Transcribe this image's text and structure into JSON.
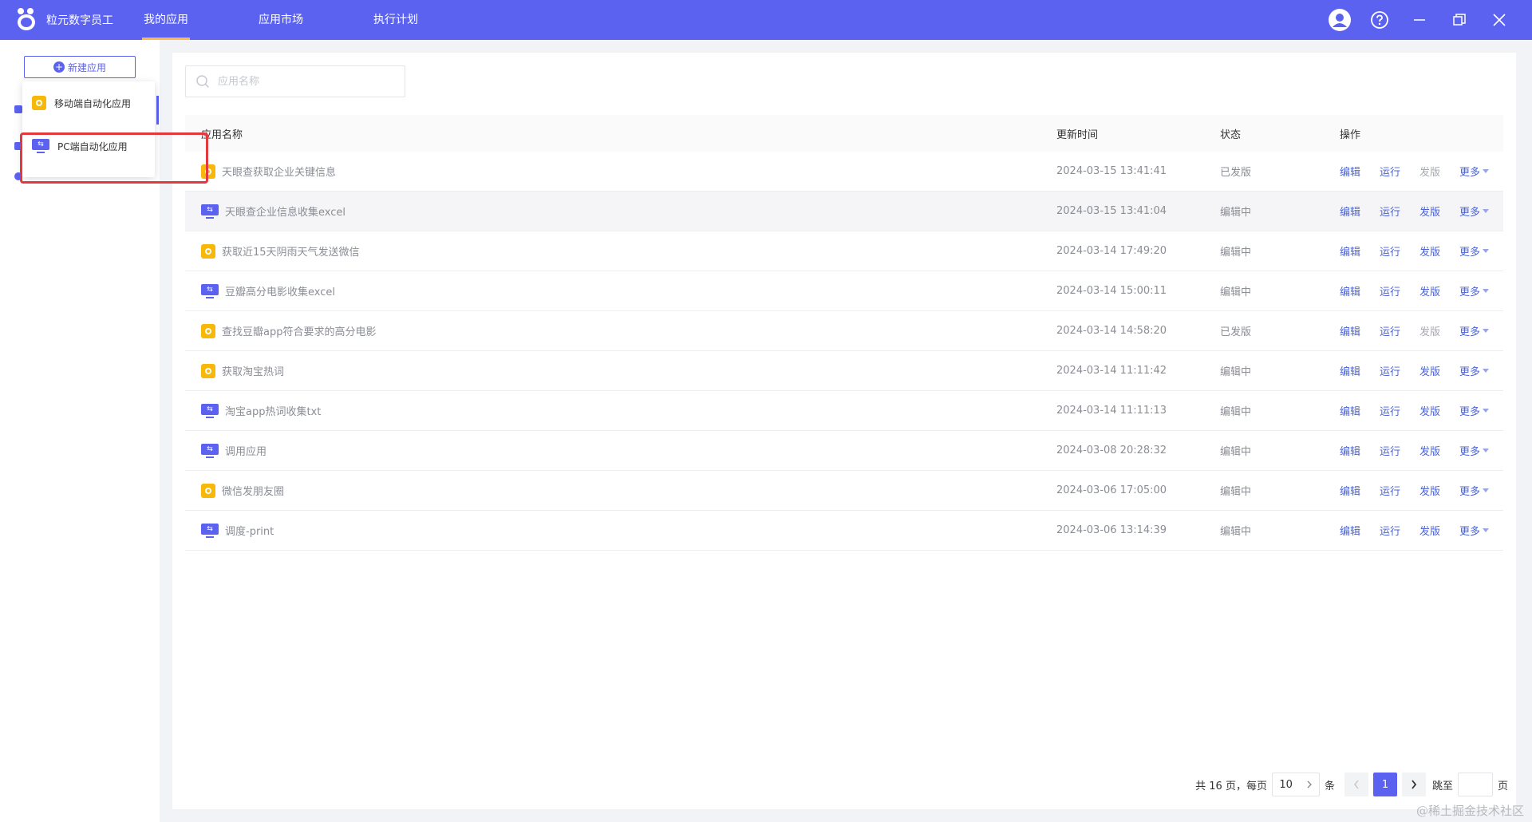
{
  "app": {
    "title": "粒元数字员工"
  },
  "nav": [
    {
      "label": "我的应用",
      "active": true
    },
    {
      "label": "应用市场",
      "active": false
    },
    {
      "label": "执行计划",
      "active": false
    }
  ],
  "window_icons": [
    "user-avatar-icon",
    "help-icon",
    "minimize-icon",
    "restore-icon",
    "close-icon"
  ],
  "sidebar": {
    "new_app_label": "新建应用"
  },
  "dropdown": {
    "items": [
      {
        "label": "移动端自动化应用",
        "icon": "mobile-app-icon"
      },
      {
        "label": "PC端自动化应用",
        "icon": "pc-app-icon"
      }
    ]
  },
  "search": {
    "placeholder": "应用名称"
  },
  "table": {
    "headers": {
      "name": "应用名称",
      "time": "更新时间",
      "status": "状态",
      "ops": "操作"
    },
    "op_labels": {
      "edit": "编辑",
      "run": "运行",
      "publish": "发版",
      "more": "更多"
    },
    "rows": [
      {
        "type": "mobile",
        "name": "天眼查获取企业关键信息",
        "time": "2024-03-15 13:41:41",
        "status": "已发版",
        "publish_disabled": true
      },
      {
        "type": "pc",
        "name": "天眼查企业信息收集excel",
        "time": "2024-03-15 13:41:04",
        "status": "编辑中",
        "publish_disabled": false
      },
      {
        "type": "mobile",
        "name": "获取近15天阴雨天气发送微信",
        "time": "2024-03-14 17:49:20",
        "status": "编辑中",
        "publish_disabled": false
      },
      {
        "type": "pc",
        "name": "豆瓣高分电影收集excel",
        "time": "2024-03-14 15:00:11",
        "status": "编辑中",
        "publish_disabled": false
      },
      {
        "type": "mobile",
        "name": "查找豆瓣app符合要求的高分电影",
        "time": "2024-03-14 14:58:20",
        "status": "已发版",
        "publish_disabled": true
      },
      {
        "type": "mobile",
        "name": "获取淘宝热词",
        "time": "2024-03-14 11:11:42",
        "status": "编辑中",
        "publish_disabled": false
      },
      {
        "type": "pc",
        "name": "淘宝app热词收集txt",
        "time": "2024-03-14 11:11:13",
        "status": "编辑中",
        "publish_disabled": false
      },
      {
        "type": "pc",
        "name": "调用应用",
        "time": "2024-03-08 20:28:32",
        "status": "编辑中",
        "publish_disabled": false
      },
      {
        "type": "mobile",
        "name": "微信发朋友圈",
        "time": "2024-03-06 17:05:00",
        "status": "编辑中",
        "publish_disabled": false
      },
      {
        "type": "pc",
        "name": "调度-print",
        "time": "2024-03-06 13:14:39",
        "status": "编辑中",
        "publish_disabled": false
      }
    ]
  },
  "pagination": {
    "total_text": "共 16 页，每页",
    "page_size": "10",
    "unit": "条",
    "current_page": "1",
    "jump_label": "跳至",
    "page_suffix": "页"
  },
  "watermark": "@稀土掘金技术社区",
  "colors": {
    "primary": "#5b62f0",
    "accent_tab": "#ffb84d",
    "link": "#4b63d6",
    "highlight": "#e3383e",
    "mobile_icon": "#f7b80a"
  }
}
